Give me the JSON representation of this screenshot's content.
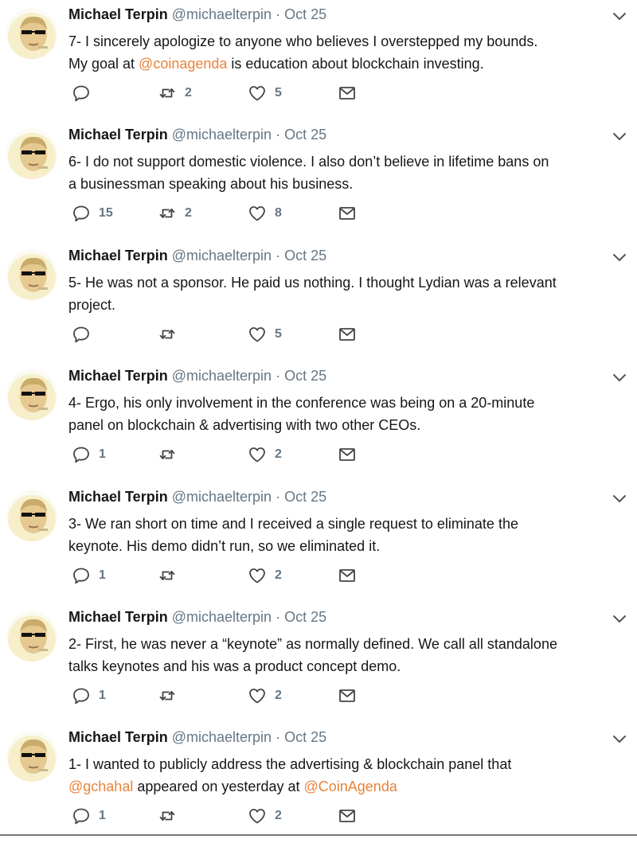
{
  "colors": {
    "text": "#14171a",
    "muted": "#657786",
    "mention": "#e8833a"
  },
  "icons": {
    "reply": "reply-icon",
    "retweet": "retweet-icon",
    "like": "heart-icon",
    "message": "envelope-icon",
    "menu": "chevron-down-icon"
  },
  "tweets": [
    {
      "name": "Michael Terpin",
      "handle": "@michaelterpin",
      "sep": "·",
      "date": "Oct 25",
      "segments": [
        {
          "text": "7- I sincerely apologize to anyone who believes I overstepped my bounds."
        },
        {
          "br": true
        },
        {
          "text": "My goal at "
        },
        {
          "text": "@coinagenda",
          "mention": true
        },
        {
          "text": " is education about blockchain investing."
        }
      ],
      "replies": "",
      "retweets": "2",
      "likes": "5"
    },
    {
      "name": "Michael Terpin",
      "handle": "@michaelterpin",
      "sep": "·",
      "date": "Oct 25",
      "segments": [
        {
          "text": "6- I do not support domestic violence.  I also don’t believe in lifetime bans on"
        },
        {
          "br": true
        },
        {
          "text": "a businessman speaking about his business."
        }
      ],
      "replies": "15",
      "retweets": "2",
      "likes": "8"
    },
    {
      "name": "Michael Terpin",
      "handle": "@michaelterpin",
      "sep": "·",
      "date": "Oct 25",
      "segments": [
        {
          "text": "5- He was not a sponsor. He paid us nothing. I thought Lydian was a relevant"
        },
        {
          "br": true
        },
        {
          "text": "project."
        }
      ],
      "replies": "",
      "retweets": "",
      "likes": "5"
    },
    {
      "name": "Michael Terpin",
      "handle": "@michaelterpin",
      "sep": "·",
      "date": "Oct 25",
      "segments": [
        {
          "text": "4- Ergo, his only involvement in the conference was being on a 20-minute"
        },
        {
          "br": true
        },
        {
          "text": "panel on blockchain & advertising with two other CEOs."
        }
      ],
      "replies": "1",
      "retweets": "",
      "likes": "2"
    },
    {
      "name": "Michael Terpin",
      "handle": "@michaelterpin",
      "sep": "·",
      "date": "Oct 25",
      "segments": [
        {
          "text": "3- We ran short on time and I received a single request to eliminate the"
        },
        {
          "br": true
        },
        {
          "text": "keynote. His demo didn’t run, so we eliminated it."
        }
      ],
      "replies": "1",
      "retweets": "",
      "likes": "2"
    },
    {
      "name": "Michael Terpin",
      "handle": "@michaelterpin",
      "sep": "·",
      "date": "Oct 25",
      "segments": [
        {
          "text": "2- First, he was never a “keynote” as normally defined. We call all standalone"
        },
        {
          "br": true
        },
        {
          "text": "talks keynotes and his was a product concept demo."
        }
      ],
      "replies": "1",
      "retweets": "",
      "likes": "2"
    },
    {
      "name": "Michael Terpin",
      "handle": "@michaelterpin",
      "sep": "·",
      "date": "Oct 25",
      "segments": [
        {
          "text": "1- I wanted to publicly address the advertising & blockchain panel that"
        },
        {
          "br": true
        },
        {
          "text": "@gchahal",
          "mention": true
        },
        {
          "text": " appeared on yesterday at "
        },
        {
          "text": "@CoinAgenda",
          "mention": true
        }
      ],
      "replies": "1",
      "retweets": "",
      "likes": "2"
    }
  ]
}
